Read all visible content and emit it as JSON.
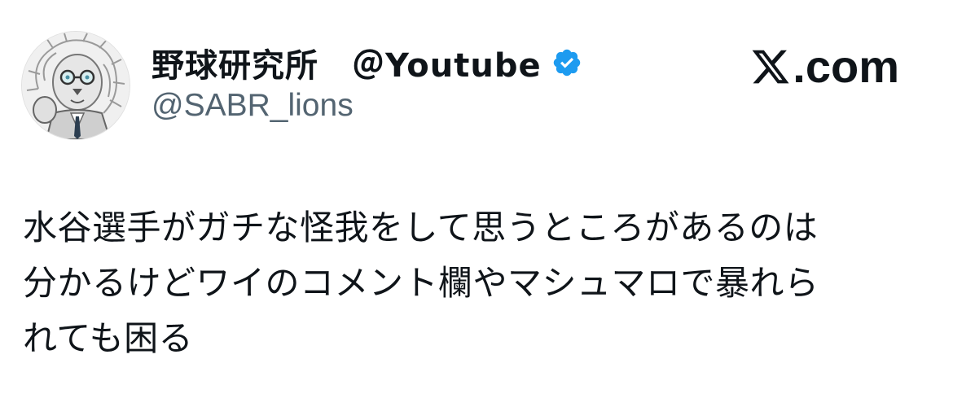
{
  "author": {
    "display_name": "野球研究所　＠Youtube",
    "handle": "@SABR_lions",
    "verified": true,
    "avatar_icon": "lion-avatar-icon"
  },
  "brand": {
    "icon": "x-logo-icon",
    "suffix": ".com"
  },
  "tweet": {
    "lines": [
      "水谷選手がガチな怪我をして思うところがあるのは",
      "分かるけどワイのコメント欄やマシュマロで暴れら",
      "れても困る"
    ]
  },
  "colors": {
    "verified_blue": "#1d9bf0",
    "text_primary": "#0f1419",
    "text_secondary": "#536471",
    "background": "#ffffff"
  }
}
